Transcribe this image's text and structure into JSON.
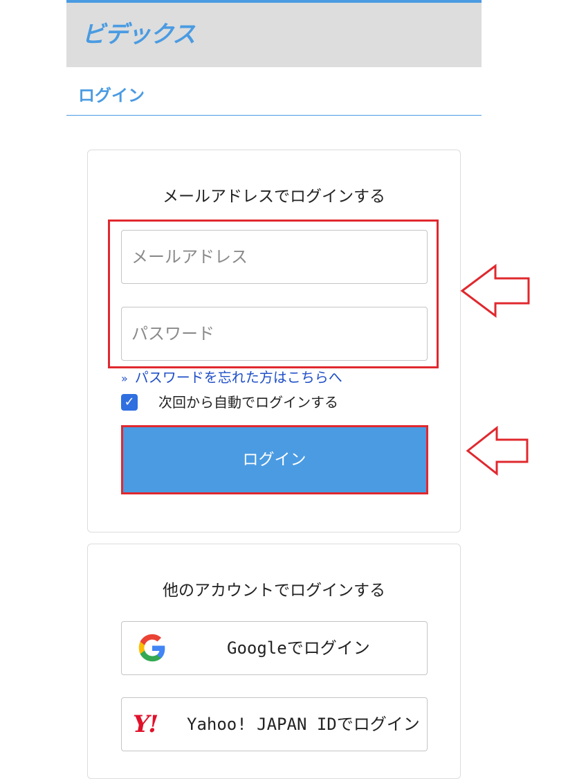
{
  "header": {
    "logo_text": "ビデックス",
    "brand_color": "#4a9be2"
  },
  "page_title": "ログイン",
  "email_login": {
    "heading": "メールアドレスでログインする",
    "email_placeholder": "メールアドレス",
    "password_placeholder": "パスワード",
    "forgot_chevron": "»",
    "forgot_link": "パスワードを忘れた方はこちらへ",
    "remember_checked": true,
    "remember_label": "次回から自動でログインする",
    "login_button": "ログイン"
  },
  "social_login": {
    "heading": "他のアカウントでログインする",
    "google_label": "Googleでログイン",
    "yahoo_icon_text": "Y!",
    "yahoo_label": "Yahoo! JAPAN IDでログイン"
  },
  "annotations": {
    "highlight_color": "#e0282e",
    "arrow_icon": "left-arrow-outline"
  }
}
